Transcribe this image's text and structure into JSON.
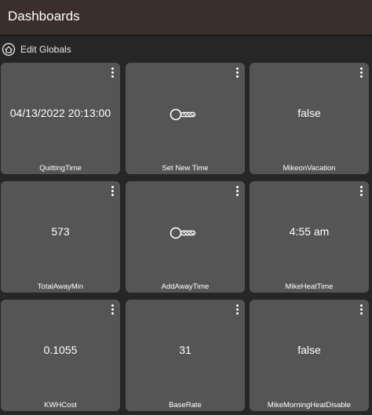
{
  "header": {
    "title": "Dashboards"
  },
  "subbar": {
    "icon": "home-gear-icon",
    "label": "Edit Globals"
  },
  "tiles": [
    {
      "value": "04/13/2022 20:13:00",
      "label": "QuittingTime",
      "type": "text"
    },
    {
      "value": "",
      "label": "Set New Time",
      "type": "button",
      "icon": "key-icon"
    },
    {
      "value": "false",
      "label": "MikeonVacation",
      "type": "text"
    },
    {
      "value": "573",
      "label": "TotalAwayMin",
      "type": "text"
    },
    {
      "value": "",
      "label": "AddAwayTime",
      "type": "button",
      "icon": "key-icon"
    },
    {
      "value": "4:55 am",
      "label": "MikeHeatTime",
      "type": "text"
    },
    {
      "value": "0.1055",
      "label": "KWHCost",
      "type": "text"
    },
    {
      "value": "31",
      "label": "BaseRate",
      "type": "text"
    },
    {
      "value": "false",
      "label": "MikeMorningHeatDisable",
      "type": "text"
    }
  ],
  "colors": {
    "header_bg": "#3a2f2b",
    "page_bg": "#262626",
    "tile_bg": "#555555",
    "text": "#ffffff"
  }
}
